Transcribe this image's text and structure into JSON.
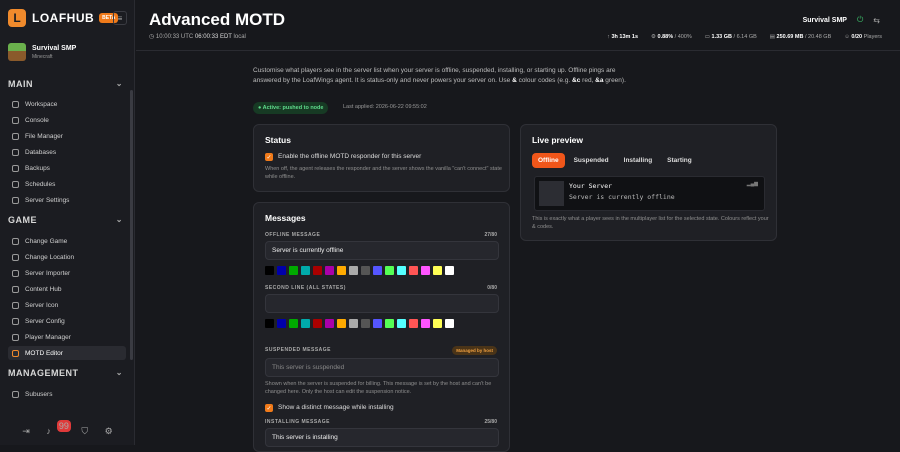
{
  "brand": {
    "name": "LOAFHUB",
    "beta": "BETA",
    "logo": "L",
    "collapse_icon": "≡"
  },
  "server": {
    "name": "Survival SMP",
    "type": "Minecraft"
  },
  "sections": {
    "main": "MAIN",
    "game": "GAME",
    "management": "MANAGEMENT"
  },
  "nav_main": [
    "Workspace",
    "Console",
    "File Manager",
    "Databases",
    "Backups",
    "Schedules",
    "Server Settings"
  ],
  "nav_game": [
    "Change Game",
    "Change Location",
    "Server Importer",
    "Content Hub",
    "Server Icon",
    "Server Config",
    "Player Manager",
    "MOTD Editor"
  ],
  "nav_management": [
    "Subusers"
  ],
  "footer": {
    "badge": "99"
  },
  "page": {
    "title": "Advanced MOTD",
    "time_utc": "10:00:33 UTC",
    "time_local": "06:00:33 EDT",
    "time_local_suffix": "local"
  },
  "topbar": {
    "server_name": "Survival SMP",
    "uptime": "3h 13m 1s",
    "cpu": "0.88%",
    "cpu_max": "/ 400%",
    "mem": "1.33 GB",
    "mem_max": "/ 6.14 GB",
    "disk": "250.69 MB",
    "disk_max": "/ 20.48 GB",
    "players": "0/20",
    "players_label": "Players"
  },
  "intro": {
    "p1": "Customise what players see in the server list when your server is offline, suspended, installing, or starting up. Offline pings are answered by the LoafWings agent. It is status-only and never powers your server on. Use ",
    "code1": "&",
    "p2": " colour codes (e.g. ",
    "code2": "&c",
    "p3": " red, ",
    "code3": "&a",
    "p4": " green)."
  },
  "status_pill": "Active: pushed to node",
  "last_applied": "Last applied: 2026-06-22 09:55:02",
  "status_card": {
    "title": "Status",
    "checkbox_label": "Enable the offline MOTD responder for this server",
    "hint": "When off, the agent releases the responder and the server shows the vanilla \"can't connect\" state while offline."
  },
  "messages": {
    "title": "Messages",
    "offline_label": "OFFLINE MESSAGE",
    "offline_count": "27/80",
    "offline_value": "Server is currently offline",
    "second_label": "SECOND LINE (ALL STATES)",
    "second_count": "0/80",
    "second_value": "",
    "suspended_label": "SUSPENDED MESSAGE",
    "suspended_badge": "Managed by host",
    "suspended_placeholder": "This server is suspended",
    "suspended_hint": "Shown when the server is suspended for billing. This message is set by the host and can't be changed here. Only the host can edit the suspension notice.",
    "distinct_label": "Show a distinct message while installing",
    "installing_label": "INSTALLING MESSAGE",
    "installing_count": "25/80",
    "installing_value": "This server is installing"
  },
  "swatch_colors": [
    "#000000",
    "#0000aa",
    "#00aa00",
    "#00aaaa",
    "#aa0000",
    "#aa00aa",
    "#ffaa00",
    "#aaaaaa",
    "#555555",
    "#5555ff",
    "#55ff55",
    "#55ffff",
    "#ff5555",
    "#ff55ff",
    "#ffff55",
    "#ffffff"
  ],
  "preview": {
    "title": "Live preview",
    "tabs": [
      "Offline",
      "Suspended",
      "Installing",
      "Starting"
    ],
    "line1": "Your Server",
    "line2": "Server is currently offline",
    "hint": "This is exactly what a player sees in the multiplayer list for the selected state. Colours reflect your & codes."
  },
  "colors": {
    "accent": "#f07a1a",
    "active_tab": "#f0561a",
    "success": "#5fdc8c"
  }
}
